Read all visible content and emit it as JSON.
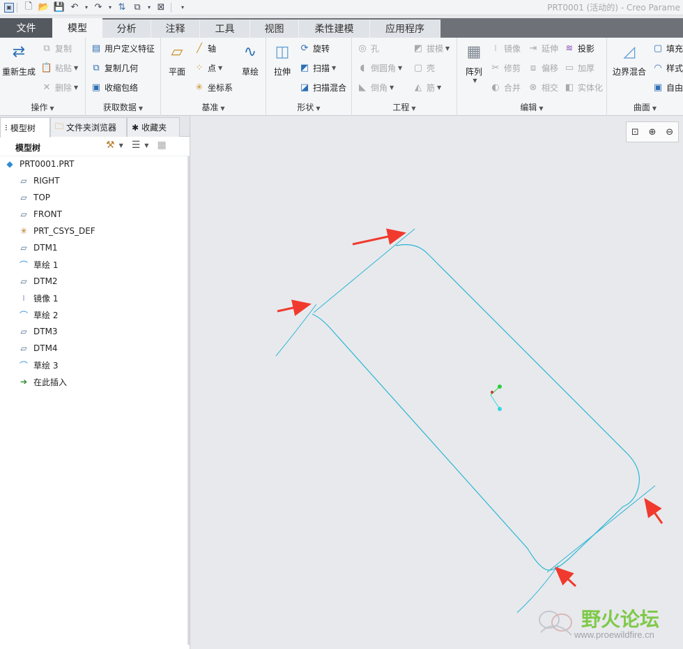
{
  "title_bar": {
    "app_title": "PRT0001 (活动的) - Creo Parame",
    "quick_access": [
      "app-icon",
      "new-icon",
      "open-icon",
      "save-icon",
      "undo-icon",
      "redo-icon",
      "regenerate-icon",
      "windows-icon",
      "close-window-icon",
      "customize-icon"
    ]
  },
  "tabs": {
    "file": "文件",
    "model": "模型",
    "analysis": "分析",
    "annotate": "注释",
    "tools": "工具",
    "view": "视图",
    "flexible": "柔性建模",
    "apps": "应用程序"
  },
  "ribbon": {
    "operations": {
      "label": "操作",
      "regenerate": "重新生成",
      "copy": "复制",
      "paste": "粘贴",
      "delete": "删除"
    },
    "get_data": {
      "label": "获取数据",
      "udf": "用户定义特征",
      "copy_geom": "复制几何",
      "shrinkwrap": "收缩包络"
    },
    "datum": {
      "label": "基准",
      "plane": "平面",
      "axis": "轴",
      "point": "点",
      "csys": "坐标系",
      "sketch": "草绘"
    },
    "shapes": {
      "label": "形状",
      "extrude": "拉伸",
      "revolve": "旋转",
      "sweep": "扫描",
      "swept_blend": "扫描混合"
    },
    "engineering": {
      "label": "工程",
      "hole": "孔",
      "round": "倒圆角",
      "chamfer": "倒角",
      "draft": "拔模",
      "shell": "壳",
      "rib": "筋"
    },
    "editing": {
      "label": "编辑",
      "pattern": "阵列",
      "mirror": "镜像",
      "trim": "修剪",
      "merge": "合并",
      "extend": "延伸",
      "offset": "偏移",
      "intersect": "相交",
      "project": "投影",
      "thicken": "加厚",
      "solidify": "实体化"
    },
    "surfaces": {
      "label": "曲面",
      "boundary_blend": "边界混合",
      "fill": "填充",
      "style": "样式",
      "freestyle": "自由式"
    }
  },
  "panel": {
    "tabs": [
      "模型树",
      "文件夹浏览器",
      "收藏夹"
    ],
    "tree_title": "模型树",
    "items": [
      {
        "label": "PRT0001.PRT",
        "icon": "part-icon"
      },
      {
        "label": "RIGHT",
        "icon": "datum-plane-icon"
      },
      {
        "label": "TOP",
        "icon": "datum-plane-icon"
      },
      {
        "label": "FRONT",
        "icon": "datum-plane-icon"
      },
      {
        "label": "PRT_CSYS_DEF",
        "icon": "csys-icon"
      },
      {
        "label": "DTM1",
        "icon": "datum-plane-icon"
      },
      {
        "label": "草绘 1",
        "icon": "sketch-icon"
      },
      {
        "label": "DTM2",
        "icon": "datum-plane-icon"
      },
      {
        "label": "镜像 1",
        "icon": "mirror-icon"
      },
      {
        "label": "草绘 2",
        "icon": "sketch-icon"
      },
      {
        "label": "DTM3",
        "icon": "datum-plane-icon"
      },
      {
        "label": "DTM4",
        "icon": "datum-plane-icon"
      },
      {
        "label": "草绘 3",
        "icon": "sketch-icon"
      },
      {
        "label": "在此插入",
        "icon": "insert-here-icon"
      }
    ]
  },
  "canvas": {
    "view_tools": [
      "zoom-fit-icon",
      "zoom-in-icon",
      "zoom-out-icon"
    ],
    "curve_color": "#29b6d6",
    "arrow_color": "#f03a2e",
    "watermark_main": "野火论坛",
    "watermark_url": "www.proewildfire.cn"
  }
}
